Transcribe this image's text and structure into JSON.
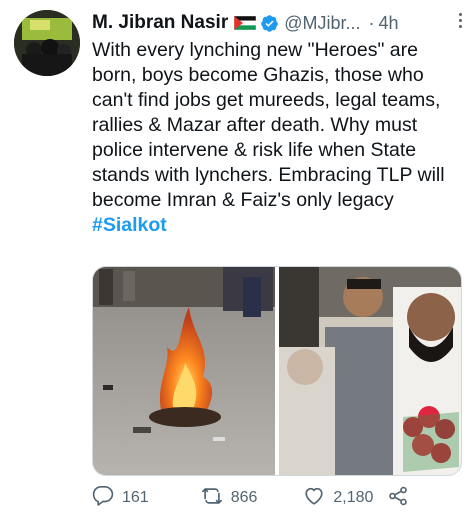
{
  "tweet": {
    "author_name": "M. Jibran Nasir",
    "handle": "@MJibr...",
    "separator": "·",
    "time": "4h",
    "body_text": "With every lynching new \"Heroes\" are born, boys become Ghazis, those who can't find jobs get mureeds, legal teams, rallies & Mazar after death. Why must police intervene & risk life when State stands with lynchers. Embracing TLP will become Imran & Faiz's only legacy ",
    "hashtag": "#Sialkot"
  },
  "actions": {
    "reply_count": "161",
    "retweet_count": "866",
    "like_count": "2,180"
  },
  "icons": {
    "verified": "verified-badge-icon",
    "flag": "flag-icon",
    "more": "more-options-icon",
    "reply": "reply-icon",
    "retweet": "retweet-icon",
    "like": "heart-icon",
    "share": "share-icon"
  },
  "colors": {
    "text": "#0f1419",
    "secondary": "#536471",
    "link": "#1d9bf0"
  }
}
